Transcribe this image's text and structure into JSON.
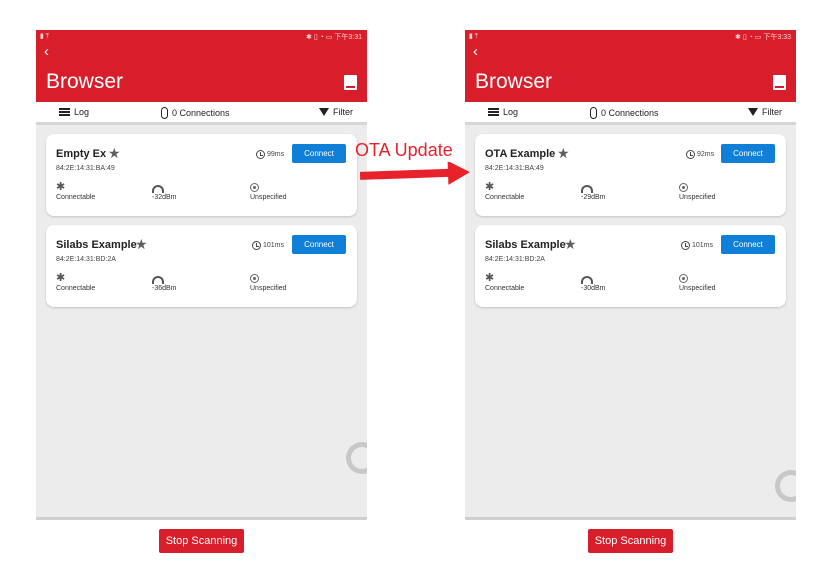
{
  "annotation": {
    "text": "OTA Update",
    "color": "#e8222a"
  },
  "colors": {
    "brand_red": "#d81e2a",
    "connect_blue": "#0f7fd8",
    "background": "#ececec"
  },
  "screens": [
    {
      "status_left": "▮ ⤒",
      "status_right": "✱ ▯ ◔ ▭ 下午3:31",
      "title": "Browser",
      "toolbar": {
        "log": "Log",
        "connections": "0 Connections",
        "filter": "Filter"
      },
      "devices": [
        {
          "name": "Empty Ex",
          "address": "84:2E:14:31:BA:49",
          "time": "99ms",
          "connect": "Connect",
          "connectable": "Connectable",
          "rssi": "-32dBm",
          "beacon": "Unspecified"
        },
        {
          "name": "Silabs Example",
          "address": "84:2E:14:31:BD:2A",
          "time": "101ms",
          "connect": "Connect",
          "connectable": "Connectable",
          "rssi": "-36dBm",
          "beacon": "Unspecified"
        }
      ],
      "stop_button": "Stop Scanning"
    },
    {
      "status_left": "▮ ⤒",
      "status_right": "✱ ▯ ◔ ▭ 下午3:33",
      "title": "Browser",
      "toolbar": {
        "log": "Log",
        "connections": "0 Connections",
        "filter": "Filter"
      },
      "devices": [
        {
          "name": "OTA Example",
          "address": "84:2E:14:31:BA:49",
          "time": "92ms",
          "connect": "Connect",
          "connectable": "Connectable",
          "rssi": "-29dBm",
          "beacon": "Unspecified"
        },
        {
          "name": "Silabs Example",
          "address": "84:2E:14:31:BD:2A",
          "time": "101ms",
          "connect": "Connect",
          "connectable": "Connectable",
          "rssi": "-30dBm",
          "beacon": "Unspecified"
        }
      ],
      "stop_button": "Stop Scanning"
    }
  ]
}
